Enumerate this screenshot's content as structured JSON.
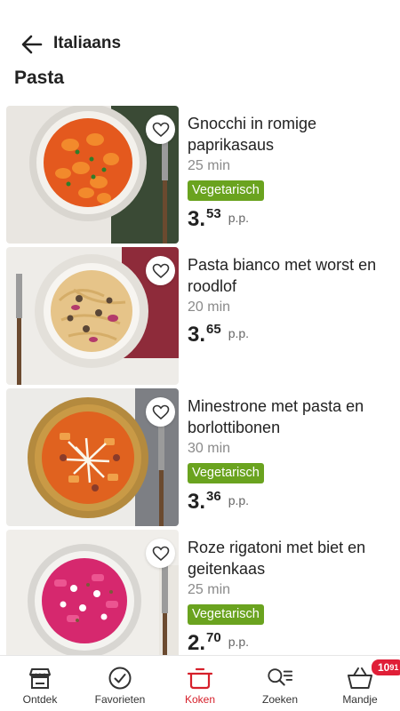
{
  "header": {
    "title": "Italiaans",
    "section": "Pasta"
  },
  "recipes": [
    {
      "title": "Gnocchi in romige paprikasaus",
      "time": "25 min",
      "badge": "Vegetarisch",
      "price_euro": "3",
      "price_cents": "53",
      "per": "p.p."
    },
    {
      "title": "Pasta bianco met worst en roodlof",
      "time": "20 min",
      "badge": "",
      "price_euro": "3",
      "price_cents": "65",
      "per": "p.p."
    },
    {
      "title": "Minestrone met pasta en borlottibonen",
      "time": "30 min",
      "badge": "Vegetarisch",
      "price_euro": "3",
      "price_cents": "36",
      "per": "p.p."
    },
    {
      "title": "Roze rigatoni met biet en geitenkaas",
      "time": "25 min",
      "badge": "Vegetarisch",
      "price_euro": "2",
      "price_cents": "70",
      "per": "p.p."
    }
  ],
  "tabbar": {
    "items": [
      {
        "label": "Ontdek",
        "icon": "store-icon"
      },
      {
        "label": "Favorieten",
        "icon": "check-circle-icon"
      },
      {
        "label": "Koken",
        "icon": "pot-icon"
      },
      {
        "label": "Zoeken",
        "icon": "search-list-icon"
      },
      {
        "label": "Mandje",
        "icon": "basket-icon"
      }
    ],
    "active": "Koken",
    "cart_euro": "10",
    "cart_cents": "91"
  },
  "colors": {
    "accent": "#d6202b",
    "vegetarian_badge": "#6aa31f",
    "cart_badge": "#e01e37"
  }
}
